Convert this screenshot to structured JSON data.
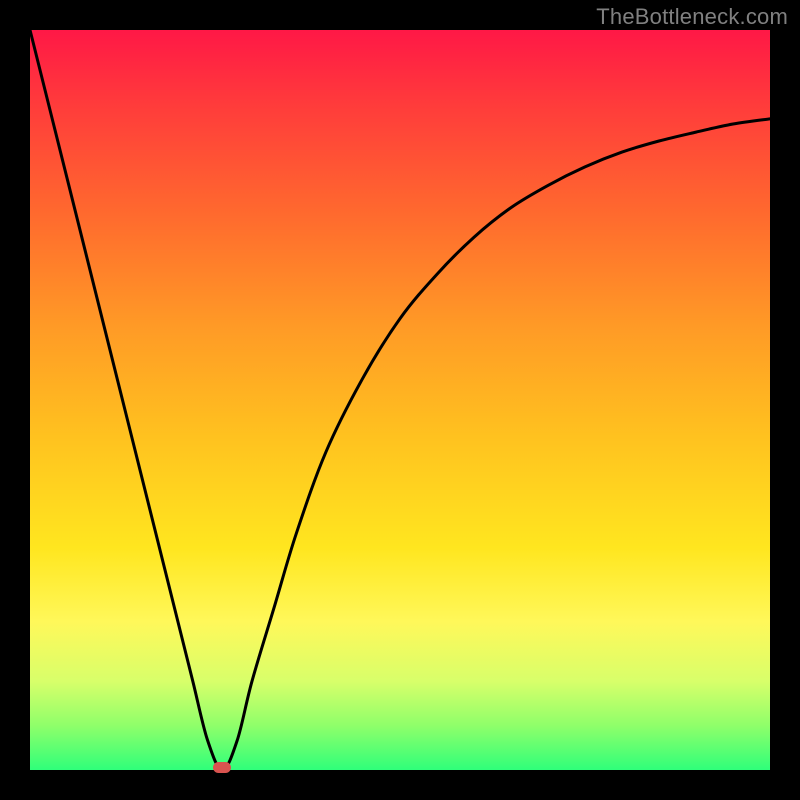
{
  "watermark": "TheBottleneck.com",
  "colors": {
    "frame": "#000000",
    "marker": "#d9534f",
    "curve": "#000000"
  },
  "chart_data": {
    "type": "line",
    "title": "",
    "xlabel": "",
    "ylabel": "",
    "xlim": [
      0,
      100
    ],
    "ylim": [
      0,
      100
    ],
    "grid": false,
    "legend": false,
    "series": [
      {
        "name": "bottleneck-curve",
        "x": [
          0,
          5,
          10,
          15,
          20,
          22,
          24,
          26,
          28,
          30,
          33,
          36,
          40,
          45,
          50,
          55,
          60,
          65,
          70,
          75,
          80,
          85,
          90,
          95,
          100
        ],
        "y": [
          100,
          80,
          60,
          40,
          20,
          12,
          4,
          0,
          4,
          12,
          22,
          32,
          43,
          53,
          61,
          67,
          72,
          76,
          79,
          81.5,
          83.5,
          85,
          86.2,
          87.3,
          88
        ]
      }
    ],
    "annotations": [
      {
        "name": "minimum",
        "x": 26,
        "y": 0
      }
    ]
  }
}
